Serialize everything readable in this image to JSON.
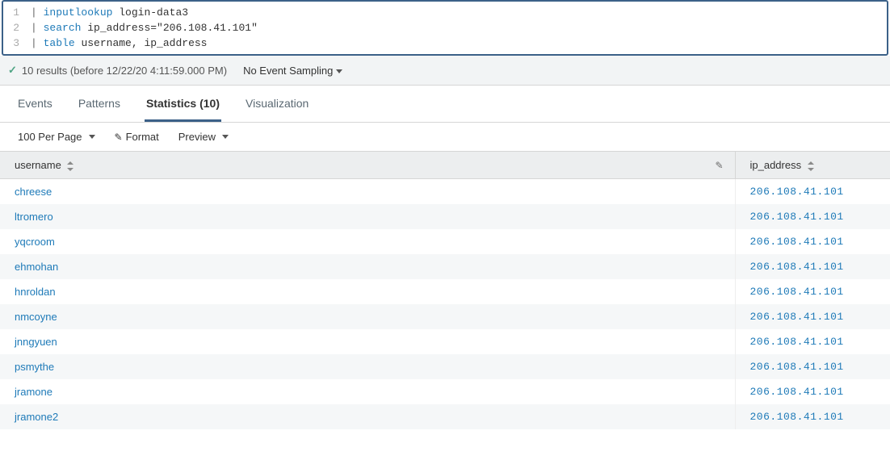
{
  "editor": {
    "line1": {
      "num": "1",
      "pipe": "|",
      "cmd": "inputlookup",
      "rest": " login-data3"
    },
    "line2": {
      "num": "2",
      "pipe": "|",
      "cmd": "search",
      "rest": " ip_address=\"206.108.41.101\""
    },
    "line3": {
      "num": "3",
      "pipe": "|",
      "cmd": "table",
      "rest": " username, ip_address"
    }
  },
  "status": {
    "results_text": "10 results (before 12/22/20 4:11:59.000 PM)",
    "sampling_label": "No Event Sampling"
  },
  "tabs": {
    "events": "Events",
    "patterns": "Patterns",
    "statistics": "Statistics (10)",
    "visualization": "Visualization"
  },
  "toolbar": {
    "per_page": "100 Per Page",
    "format": "Format",
    "preview": "Preview"
  },
  "columns": {
    "username": "username",
    "ip_address": "ip_address"
  },
  "rows": [
    {
      "username": "chreese",
      "ip": "206.108.41.101"
    },
    {
      "username": "ltromero",
      "ip": "206.108.41.101"
    },
    {
      "username": "yqcroom",
      "ip": "206.108.41.101"
    },
    {
      "username": "ehmohan",
      "ip": "206.108.41.101"
    },
    {
      "username": "hnroldan",
      "ip": "206.108.41.101"
    },
    {
      "username": "nmcoyne",
      "ip": "206.108.41.101"
    },
    {
      "username": "jnngyuen",
      "ip": "206.108.41.101"
    },
    {
      "username": "psmythe",
      "ip": "206.108.41.101"
    },
    {
      "username": "jramone",
      "ip": "206.108.41.101"
    },
    {
      "username": "jramone2",
      "ip": "206.108.41.101"
    }
  ]
}
